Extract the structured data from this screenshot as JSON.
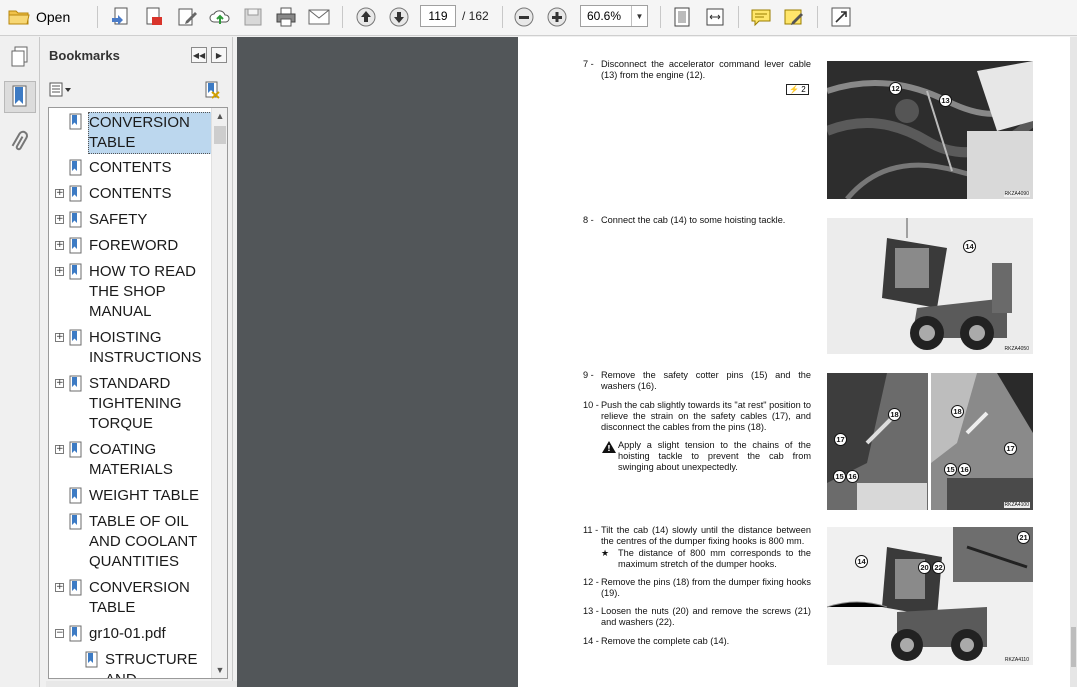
{
  "toolbar": {
    "open_label": "Open",
    "page_current": "119",
    "page_total": "/  162",
    "zoom": "60.6%"
  },
  "bookmarks": {
    "title": "Bookmarks",
    "items": [
      {
        "label": "CONVERSION TABLE",
        "expandable": false,
        "selected": true
      },
      {
        "label": "CONTENTS",
        "expandable": false
      },
      {
        "label": "CONTENTS",
        "expandable": true
      },
      {
        "label": "SAFETY",
        "expandable": true
      },
      {
        "label": "FOREWORD",
        "expandable": true
      },
      {
        "label": "HOW TO READ THE SHOP MANUAL",
        "expandable": true
      },
      {
        "label": "HOISTING INSTRUCTIONS",
        "expandable": true
      },
      {
        "label": "STANDARD TIGHTENING TORQUE",
        "expandable": true
      },
      {
        "label": "COATING MATERIALS",
        "expandable": true
      },
      {
        "label": "WEIGHT TABLE",
        "expandable": false
      },
      {
        "label": "TABLE OF OIL AND COOLANT QUANTITIES",
        "expandable": false
      },
      {
        "label": "CONVERSION TABLE",
        "expandable": true
      },
      {
        "label": "gr10-01.pdf",
        "expandable": true,
        "expanded": true
      },
      {
        "label": "STRUCTURE AND",
        "expandable": false
      }
    ]
  },
  "document": {
    "steps": [
      {
        "num": "7 -",
        "text": "Disconnect the accelerator command lever cable (13) from the engine (12)."
      },
      {
        "num": "8 -",
        "text": "Connect the cab (14) to some hoisting tackle."
      },
      {
        "num": "9 -",
        "text": "Remove the safety cotter pins (15) and the washers (16)."
      },
      {
        "num": "10 -",
        "text": "Push the cab slightly towards its \"at rest\" position to relieve the strain on the safety cables (17), and disconnect the cables from the pins (18)."
      },
      {
        "num": "11 -",
        "text": "Tilt the cab (14) slowly until the distance between the centres of the dumper fixing hooks is 800 mm."
      },
      {
        "num": "12 -",
        "text": "Remove the pins (18) from the dumper fixing hooks (19)."
      },
      {
        "num": "13 -",
        "text": "Loosen the nuts (20) and remove the screws (21) and washers (22)."
      },
      {
        "num": "14 -",
        "text": "Remove the complete cab (14)."
      }
    ],
    "warning_note": "Apply a slight tension to the chains of the hoisting tackle to prevent the cab from swinging about unexpectedly.",
    "star_note": "The distance of 800 mm corresponds to the maximum stretch of the dumper hooks.",
    "badge": "2",
    "photo_codes": [
      "RKZA4090",
      "RKZA4050",
      "RKZA4100",
      "RKZA4110"
    ],
    "callouts": {
      "p1": [
        "12",
        "13"
      ],
      "p2": [
        "14"
      ],
      "p3": [
        "18",
        "17",
        "15",
        "16",
        "18",
        "17",
        "15",
        "16"
      ],
      "p4": [
        "14",
        "20",
        "22",
        "21"
      ]
    }
  }
}
